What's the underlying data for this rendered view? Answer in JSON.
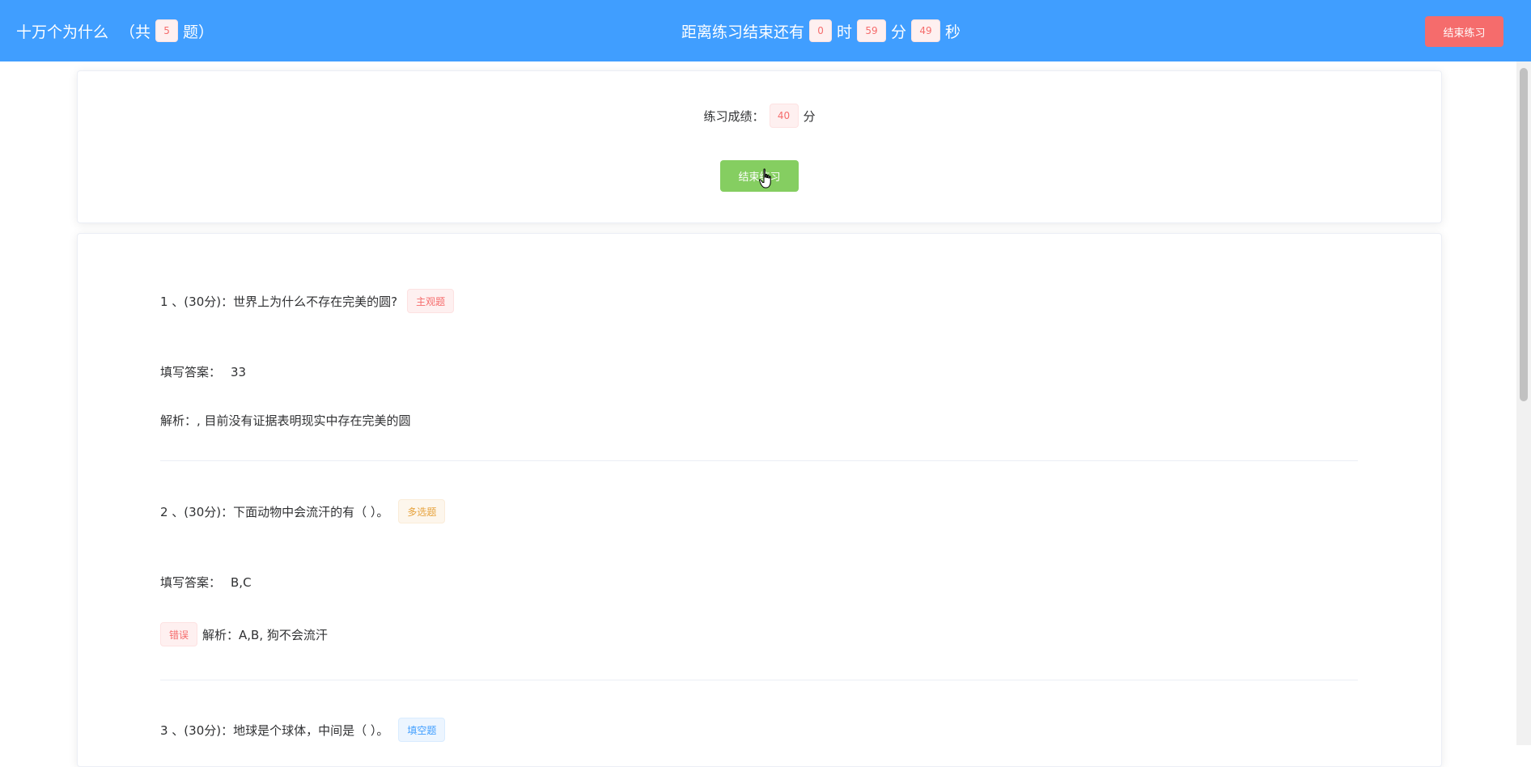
{
  "header": {
    "title": "十万个为什么",
    "count_prefix": "（共",
    "count": "5",
    "count_suffix": "题）",
    "timer_prefix": "距离练习结束还有",
    "hours": "0",
    "hours_unit": "时",
    "minutes": "59",
    "minutes_unit": "分",
    "seconds": "49",
    "seconds_unit": "秒",
    "end_button": "结束练习"
  },
  "score": {
    "label": "练习成绩：",
    "value": "40",
    "unit": "分",
    "finish_button": "结束练习"
  },
  "questions": [
    {
      "title": "1 、(30分)：世界上为什么不存在完美的圆?",
      "tag": "主观题",
      "answer_label": "填写答案：",
      "answer": "33",
      "analysis": "解析：, 目前没有证据表明现实中存在完美的圆"
    },
    {
      "title": "2 、(30分)：下面动物中会流汗的有（ ）。",
      "tag": "多选题",
      "answer_label": "填写答案：",
      "answer": "B,C",
      "result_tag": "错误",
      "analysis": "解析：A,B, 狗不会流汗"
    },
    {
      "title": "3 、(30分)：地球是个球体，中间是（ ）。",
      "tag": "填空题"
    }
  ],
  "colors": {
    "primary": "#409eff",
    "danger": "#f56c6c",
    "success": "#85ce61",
    "warning": "#e6a23c"
  }
}
